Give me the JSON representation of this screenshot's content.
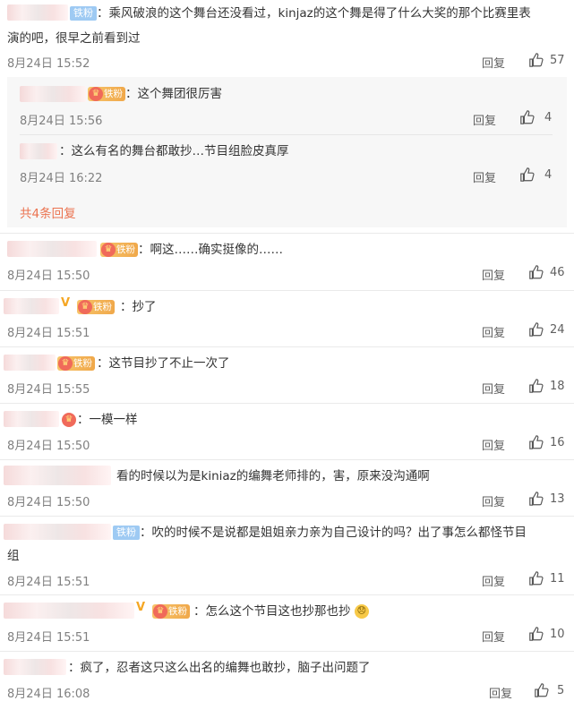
{
  "labels": {
    "reply": "回复",
    "fan_badge": "铁粉",
    "gold_badge": "铁粉",
    "v_mark": "V"
  },
  "comments": [
    {
      "text": "：乘风破浪的这个舞台还没看过，kinjaz的这个舞是得了什么大奖的那个比赛里表",
      "text2": "演的吧，很早之前看到过",
      "time": "8月24日 15:52",
      "likes": "57"
    },
    {
      "text": "：啊这……确实挺像的……",
      "time": "8月24日 15:50",
      "likes": "46"
    },
    {
      "text": "：抄了",
      "time": "8月24日 15:51",
      "likes": "24"
    },
    {
      "text": "：这节目抄了不止一次了",
      "time": "8月24日 15:55",
      "likes": "18"
    },
    {
      "text": "：一模一样",
      "time": "8月24日 15:50",
      "likes": "16"
    },
    {
      "text": "看的时候以为是kiniaz的编舞老师排的，害，原来没沟通啊",
      "time": "8月24日 15:50",
      "likes": "13"
    },
    {
      "text": "：吹的时候不是说都是姐姐亲力亲为自己设计的吗？出了事怎么都怪节目",
      "text2": "组",
      "time": "8月24日 15:51",
      "likes": "11"
    },
    {
      "text": "：怎么这个节目这也抄那也抄",
      "emoji": "😞",
      "time": "8月24日 15:51",
      "likes": "10"
    },
    {
      "text": "：疯了，忍者这只这么出名的编舞也敢抄，脑子出问题了",
      "time": "8月24日 16:08",
      "likes": "5"
    }
  ],
  "replies": [
    {
      "text": "：这个舞团很厉害",
      "time": "8月24日 15:56",
      "likes": "4"
    },
    {
      "text": "：这么有名的舞台都敢抄…节目组脸皮真厚",
      "time": "8月24日 16:22",
      "likes": "4"
    }
  ],
  "more_replies": "共4条回复",
  "colors": {
    "accent": "#eb7350",
    "fan_badge": "#9ecaf3",
    "gold_badge": "#f0a84a",
    "sub_bg": "#f7f7f7"
  },
  "icons": {
    "like": "thumbs-up-icon"
  }
}
